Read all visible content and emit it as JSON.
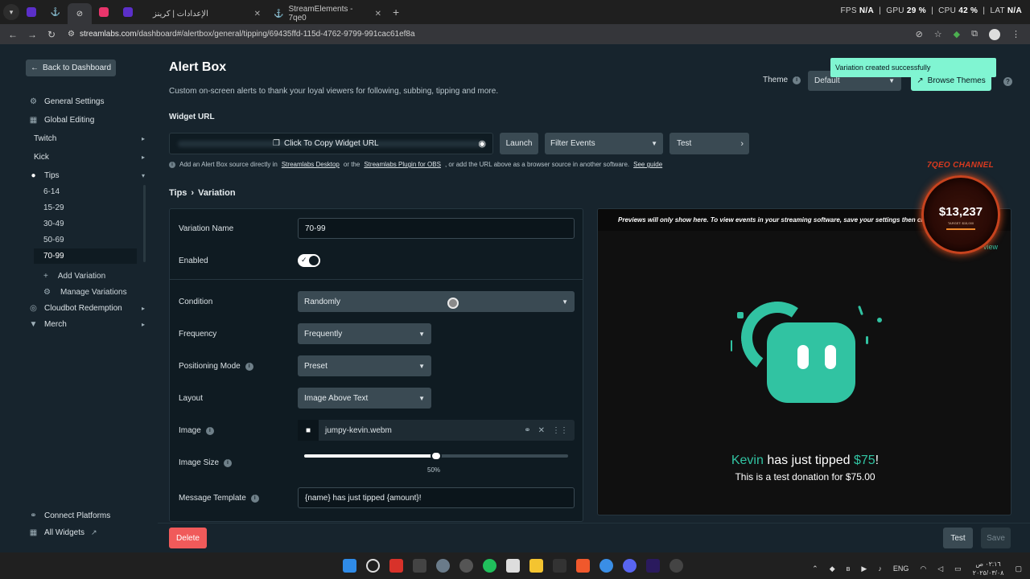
{
  "browser": {
    "tabs": [
      {
        "label": "الإعدادات | كرينز"
      },
      {
        "label": "StreamElements - 7qe0"
      }
    ],
    "url_domain": "streamlabs.com",
    "url_path": "/dashboard#/alertbox/general/tipping/69435ffd-115d-4762-9799-991cac61ef8a",
    "perf": {
      "fps_label": "FPS",
      "fps_val": "N/A",
      "gpu_label": "GPU",
      "gpu_val": "29 %",
      "cpu_label": "CPU",
      "cpu_val": "42 %",
      "lat_label": "LAT",
      "lat_val": "N/A"
    }
  },
  "sidebar": {
    "back": "Back to Dashboard",
    "items": [
      {
        "label": "General Settings"
      },
      {
        "label": "Global Editing"
      },
      {
        "label": "Twitch"
      },
      {
        "label": "Kick"
      },
      {
        "label": "Tips"
      }
    ],
    "tip_variations": [
      "6-14",
      "15-29",
      "30-49",
      "50-69",
      "70-99"
    ],
    "add_variation": "Add Variation",
    "manage_variations": "Manage Variations",
    "cloudbot": "Cloudbot Redemption",
    "merch": "Merch",
    "connect_platforms": "Connect Platforms",
    "all_widgets": "All Widgets"
  },
  "header": {
    "title": "Alert Box",
    "description": "Custom on-screen alerts to thank your loyal viewers for following, subbing, tipping and more.",
    "theme_label": "Theme",
    "theme_value": "Default",
    "browse_themes": "Browse Themes",
    "toast": "Variation created successfully"
  },
  "widget": {
    "label": "Widget URL",
    "copy": "Click To Copy Widget URL",
    "launch": "Launch",
    "filter": "Filter Events",
    "test": "Test",
    "hint_a": "Add an Alert Box source directly in",
    "hint_link1": "Streamlabs Desktop",
    "hint_b": "or the",
    "hint_link2": "Streamlabs Plugin for OBS",
    "hint_c": ", or add the URL above as a browser source in another software.",
    "hint_link3": "See guide"
  },
  "breadcrumb": {
    "parent": "Tips",
    "current": "Variation"
  },
  "form": {
    "variation_name_label": "Variation Name",
    "variation_name_value": "70-99",
    "enabled_label": "Enabled",
    "enabled": true,
    "condition_label": "Condition",
    "condition_value": "Randomly",
    "frequency_label": "Frequency",
    "frequency_value": "Frequently",
    "positioning_label": "Positioning Mode",
    "positioning_value": "Preset",
    "layout_label": "Layout",
    "layout_value": "Image Above Text",
    "image_label": "Image",
    "image_file": "jumpy-kevin.webm",
    "image_size_label": "Image Size",
    "image_size_value": "50%",
    "image_size_fraction": 0.5,
    "message_label": "Message Template",
    "message_value": "{name} has just tipped {amount}!"
  },
  "preview": {
    "header": "Previews will only show here. To view events in your streaming software, save your settings then click the \"Test\"",
    "view_link": "view",
    "alert_name": "Kevin",
    "alert_mid": " has just tipped ",
    "alert_amount": "$75",
    "alert_end": "!",
    "alert_sub": "This is a test donation for $75.00"
  },
  "overlay": {
    "channel": "7QEO CHANNEL",
    "amount": "$13,237",
    "target": "TARGET: $15,000"
  },
  "footer": {
    "delete": "Delete",
    "test": "Test",
    "save": "Save"
  },
  "taskbar": {
    "lang": "ENG",
    "time": "٠٢:١٦ ص",
    "date": "٢٠٢٥/٠٣/٠٨"
  },
  "colors": {
    "accent": "#80f5d2",
    "bot": "#31c3a2",
    "danger": "#f05a5a",
    "bg": "#17242d"
  }
}
